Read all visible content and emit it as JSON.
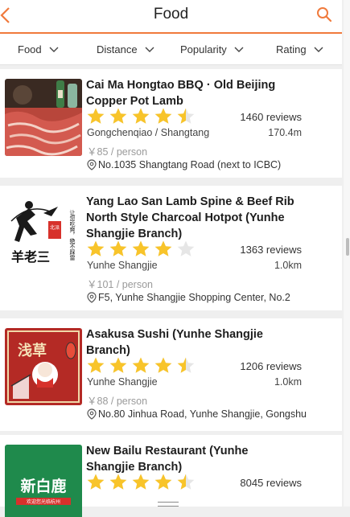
{
  "header": {
    "title": "Food"
  },
  "filters": [
    "Food",
    "Distance",
    "Popularity",
    "Rating"
  ],
  "restaurants": [
    {
      "name": "Cai Ma Hongtao BBQ · Old Beijing Copper Pot Lamb",
      "rating": 4.5,
      "reviews": "1460 reviews",
      "area": "Gongchenqiao / Shangtang",
      "distance": "170.4m",
      "price": "￥85 / person",
      "address": "No.1035 Shangtang Road (next to ICBC)"
    },
    {
      "name": "Yang Lao San Lamb Spine & Beef Rib North Style Charcoal Hotpot (Yunhe Shangjie Branch)",
      "rating": 4,
      "reviews": "1363 reviews",
      "area": "Yunhe Shangjie",
      "distance": "1.0km",
      "price": "￥101 / person",
      "address": "F5, Yunhe Shangjie Shopping Center, No.2"
    },
    {
      "name": "Asakusa Sushi (Yunhe Shangjie Branch)",
      "rating": 4.5,
      "reviews": "1206 reviews",
      "area": "Yunhe Shangjie",
      "distance": "1.0km",
      "price": "￥88 / person",
      "address": "No.80 Jinhua Road, Yunhe Shangjie, Gongshu"
    },
    {
      "name": "New Bailu Restaurant (Yunhe Shangjie Branch)",
      "rating": 4.5,
      "reviews": "8045 reviews"
    }
  ],
  "thumbs": {
    "yang_logo": "羊老三",
    "yang_slogan_1": "让您吃爽，绝不踩雷",
    "yang_seal": "北派",
    "asakusa_sign": "浅草",
    "bailu_name": "新白鹿",
    "bailu_sub": "欢迎您光临杭州"
  },
  "colors": {
    "accent": "#f07a3c",
    "star": "#f8c42a",
    "star_empty": "#e6e6e6"
  }
}
